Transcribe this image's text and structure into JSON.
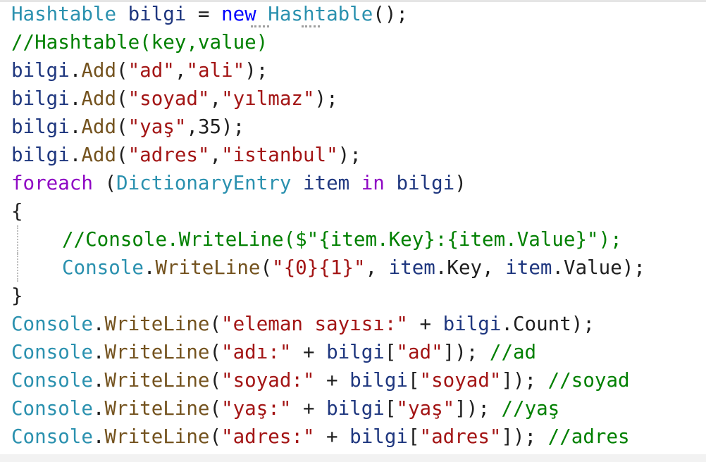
{
  "code": {
    "l1": {
      "t1": "Hashtable",
      "sp1": " ",
      "v1": "bilgi",
      "eq": " = ",
      "k1": "new",
      "sp2": " ",
      "t2": "Hashtable",
      "end": "();"
    },
    "l2": {
      "c": "//Hashtable(key,value)"
    },
    "l3": {
      "v": "bilgi",
      "dot": ".",
      "m": "Add",
      "o": "(",
      "s1": "\"ad\"",
      "comma": ",",
      "s2": "\"ali\"",
      "end": ");"
    },
    "l4": {
      "v": "bilgi",
      "dot": ".",
      "m": "Add",
      "o": "(",
      "s1": "\"soyad\"",
      "comma": ",",
      "s2": "\"yılmaz\"",
      "end": ");"
    },
    "l5": {
      "v": "bilgi",
      "dot": ".",
      "m": "Add",
      "o": "(",
      "s1": "\"yaş\"",
      "rest": ",35);"
    },
    "l6": {
      "v": "bilgi",
      "dot": ".",
      "m": "Add",
      "o": "(",
      "s1": "\"adres\"",
      "comma": ",",
      "s2": "\"istanbul\"",
      "end": ");"
    },
    "l7": {
      "k": "foreach",
      "o": " (",
      "t": "DictionaryEntry",
      "sp": " ",
      "v1": "item",
      "sp2": " ",
      "k2": "in",
      "sp3": " ",
      "v2": "bilgi",
      "end": ")"
    },
    "l8": {
      "p": "{"
    },
    "l9": {
      "c": "//Console.WriteLine($\"{item.Key}:{item.Value}\");"
    },
    "l10": {
      "t": "Console",
      "dot": ".",
      "m": "WriteLine",
      "o": "(",
      "s": "\"{0}{1}\"",
      "c1": ", ",
      "v1": "item",
      "d1": ".",
      "p1": "Key",
      "c2": ", ",
      "v2": "item",
      "d2": ".",
      "p2": "Value",
      "end": ");"
    },
    "l11": {
      "p": "}"
    },
    "l12": {
      "t": "Console",
      "dot": ".",
      "m": "WriteLine",
      "o": "(",
      "s": "\"eleman sayısı:\"",
      "plus": " + ",
      "v": "bilgi",
      "d": ".",
      "p": "Count",
      "end": ");"
    },
    "l13": {
      "t": "Console",
      "dot": ".",
      "m": "WriteLine",
      "o": "(",
      "s": "\"adı:\"",
      "plus": " + ",
      "v": "bilgi",
      "br": "[",
      "s2": "\"ad\"",
      "end": "]); ",
      "c": "//ad"
    },
    "l14": {
      "t": "Console",
      "dot": ".",
      "m": "WriteLine",
      "o": "(",
      "s": "\"soyad:\"",
      "plus": " + ",
      "v": "bilgi",
      "br": "[",
      "s2": "\"soyad\"",
      "end": "]); ",
      "c": "//soyad"
    },
    "l15": {
      "t": "Console",
      "dot": ".",
      "m": "WriteLine",
      "o": "(",
      "s": "\"yaş:\"",
      "plus": " + ",
      "v": "bilgi",
      "br": "[",
      "s2": "\"yaş\"",
      "end": "]); ",
      "c": "//yaş"
    },
    "l16": {
      "t": "Console",
      "dot": ".",
      "m": "WriteLine",
      "o": "(",
      "s": "\"adres:\"",
      "plus": " + ",
      "v": "bilgi",
      "br": "[",
      "s2": "\"adres\"",
      "end": "]); ",
      "c": "//adres"
    }
  },
  "colors": {
    "keyword": "#0000ff",
    "control_keyword": "#8f08c4",
    "type": "#2b91af",
    "variable": "#1f377f",
    "method": "#74531f",
    "string": "#a31515",
    "comment": "#008000"
  }
}
